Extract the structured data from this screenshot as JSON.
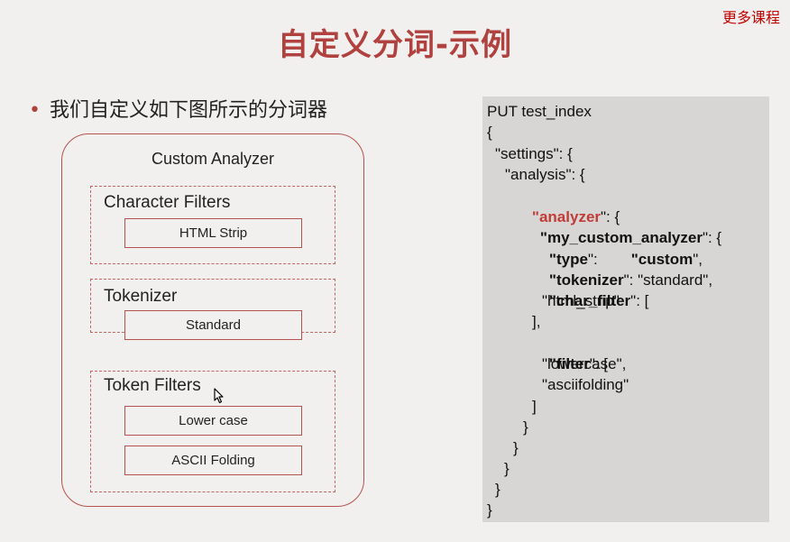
{
  "watermark": "更多课程",
  "slide": {
    "title": "自定义分词-示例",
    "bullet": "我们自定义如下图所示的分词器"
  },
  "diagram": {
    "title": "Custom Analyzer",
    "stages": [
      {
        "label": "Character Filters",
        "components": [
          "HTML Strip"
        ]
      },
      {
        "label": "Tokenizer",
        "components": [
          "Standard"
        ]
      },
      {
        "label": "Token Filters",
        "components": [
          "Lower case",
          "ASCII Folding"
        ]
      }
    ]
  },
  "code": {
    "l1": "PUT test_index",
    "l2": "{",
    "l3": "\"settings\": {",
    "l4": "\"analysis\": {",
    "l5_q1": "\"",
    "l5_key": "analyzer",
    "l5_rest": "\": {",
    "l6_key": "\"my_custom_analyzer",
    "l6_rest": "\": {",
    "l7_q": "\"",
    "l7_key": "type",
    "l7_mid": "\":",
    "l7_val_q": "\"",
    "l7_val": "custom",
    "l7_end": "\",",
    "l8_q": "\"",
    "l8_key": "tokenizer",
    "l8_rest": "\": \"standard\",",
    "l9_q": "\"",
    "l9_key": "char_filter",
    "l9_rest": "\": [",
    "l10": "\"html_strip\"",
    "l11": "],",
    "l12_q": "\"",
    "l12_key": "filter",
    "l12_rest": "\": [",
    "l13": "\"lowercase\",",
    "l14": "\"asciifolding\"",
    "l15": "]",
    "l16": "}",
    "l17": "}",
    "l18": "}",
    "l19": "}",
    "l20": "}"
  }
}
